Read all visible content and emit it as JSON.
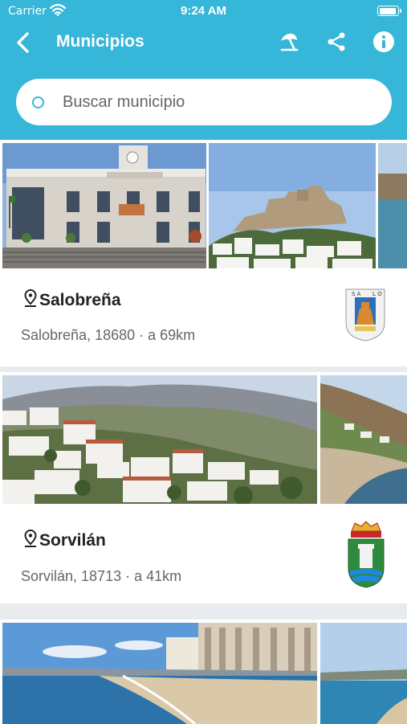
{
  "status_bar": {
    "carrier": "Carrier",
    "time": "9:24 AM"
  },
  "navbar": {
    "title": "Municipios",
    "icons": [
      "back-icon",
      "beach-umbrella-icon",
      "share-icon",
      "info-icon"
    ]
  },
  "search": {
    "placeholder": "Buscar municipio",
    "value": ""
  },
  "municipalities": [
    {
      "name": "Salobreña",
      "subtitle": "Salobreña, 18680 · a 69km",
      "photos": [
        "town-hall-photo",
        "castle-photo",
        "coast-photo"
      ]
    },
    {
      "name": "Sorvilán",
      "subtitle": "Sorvilán, 18713 · a 41km",
      "photos": [
        "village-photo",
        "beach-photo"
      ]
    },
    {
      "name": "",
      "subtitle": "",
      "photos": [
        "seafront-photo",
        "coast-photo"
      ]
    }
  ],
  "colors": {
    "header": "#36b6d8",
    "background": "#e9ecef",
    "card": "#ffffff"
  }
}
